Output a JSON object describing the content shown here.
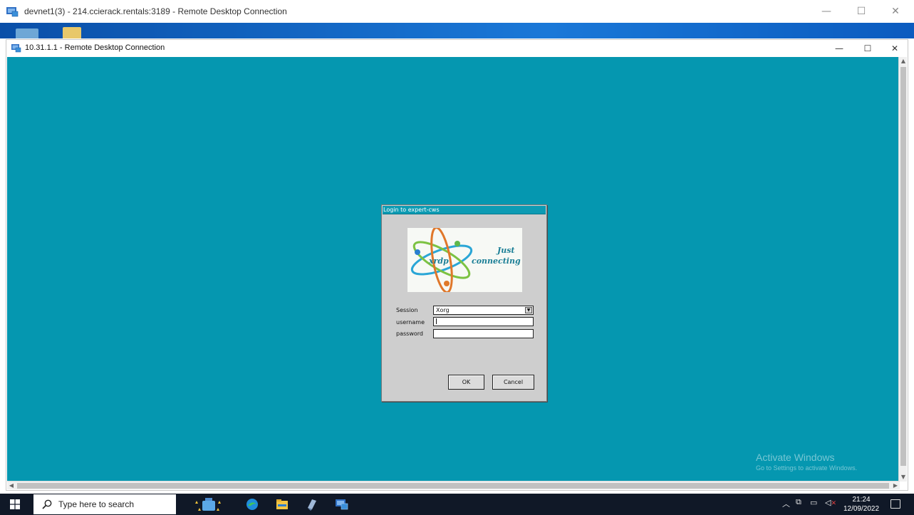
{
  "outer_window": {
    "title": "devnet1(3) - 214.ccierack.rentals:3189 - Remote Desktop Connection",
    "minimize": "—",
    "maximize": "☐",
    "close": "✕"
  },
  "inner_window": {
    "title": "10.31.1.1 - Remote Desktop Connection",
    "minimize": "—",
    "maximize": "☐",
    "close": "✕"
  },
  "login_dialog": {
    "title": "Login to expert-cws",
    "logo": {
      "brand": "xrdp",
      "tagline_line1": "Just",
      "tagline_line2": "connecting"
    },
    "session_label": "Session",
    "session_value": "Xorg",
    "username_label": "username",
    "username_value": "",
    "password_label": "password",
    "password_value": "",
    "ok_label": "OK",
    "cancel_label": "Cancel"
  },
  "watermark": {
    "title": "Activate Windows",
    "subtitle": "Go to Settings to activate Windows."
  },
  "taskbar": {
    "search_placeholder": "Type here to search",
    "clock_time": "21:24",
    "clock_date": "12/09/2022"
  },
  "colors": {
    "remote_background": "#0597b0",
    "dialog_title_bar": "#0d9bb3",
    "taskbar": "#101827"
  }
}
